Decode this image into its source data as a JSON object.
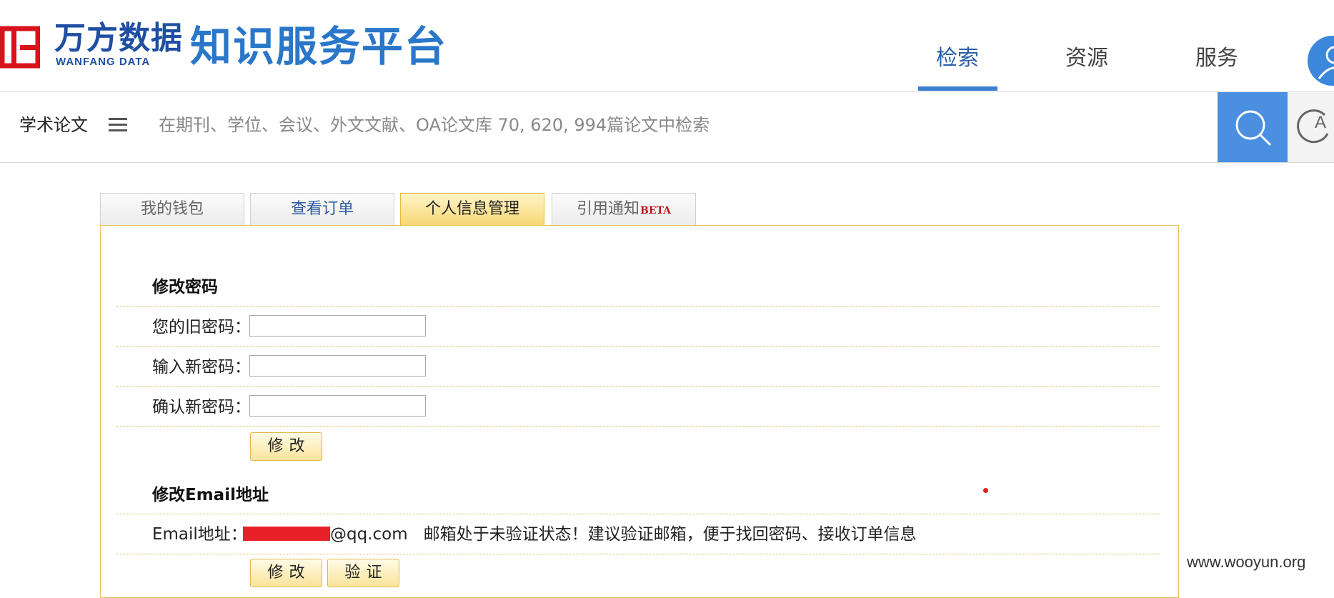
{
  "header": {
    "brand_cn": "万方数据",
    "brand_en": "WANFANG DATA",
    "platform_title": "知识服务平台",
    "nav": [
      {
        "label": "检索"
      },
      {
        "label": "资源"
      },
      {
        "label": "服务"
      }
    ],
    "active_nav": "检索"
  },
  "search": {
    "type_label": "学术论文",
    "placeholder": "在期刊、学位、会议、外文文献、OA论文库 70, 620, 994篇论文中检索"
  },
  "tabs": [
    {
      "label": "我的钱包"
    },
    {
      "label": "查看订单"
    },
    {
      "label": "个人信息管理"
    },
    {
      "label": "引用通知",
      "badge": "BETA"
    }
  ],
  "active_tab": "个人信息管理",
  "password_section": {
    "title": "修改密码",
    "old_label": "您的旧密码：",
    "new_label": "输入新密码：",
    "confirm_label": "确认新密码：",
    "submit_label": "修改"
  },
  "email_section": {
    "title": "修改Email地址",
    "label": "Email地址：",
    "email_suffix": "@qq.com",
    "status_msg": "邮箱处于未验证状态！建议验证邮箱，便于找回密码、接收订单信息",
    "modify_label": "修改",
    "verify_label": "验证"
  },
  "watermark": "www.wooyun.org",
  "colors": {
    "brand_blue": "#1f4fa3",
    "accent_blue": "#4a8fe0",
    "tab_active": "#f7d774",
    "panel_border": "#e3c257"
  }
}
